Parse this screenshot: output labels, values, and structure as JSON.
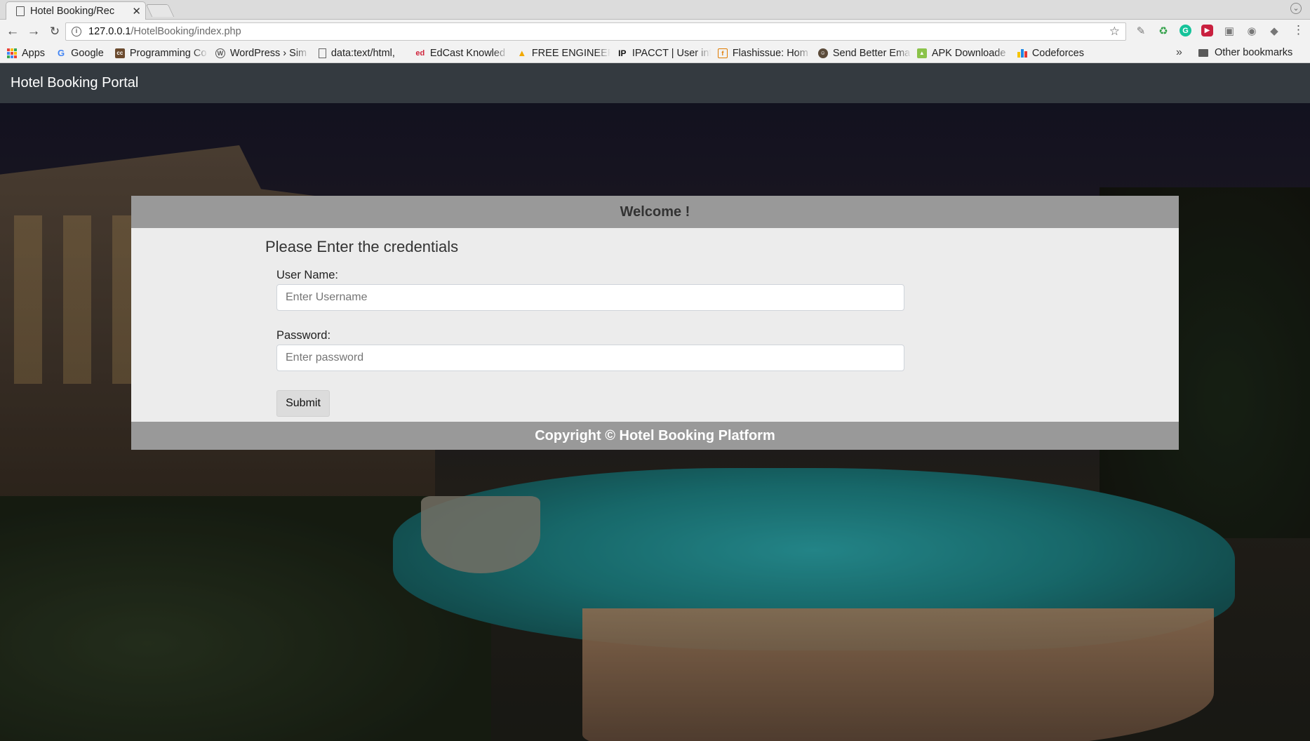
{
  "browser": {
    "tab_title": "Hotel Booking/Rec",
    "url_host": "127.0.0.1",
    "url_path": "/HotelBooking/index.php",
    "bookmarks": [
      {
        "label": "Apps",
        "icon": "apps-grid-icon"
      },
      {
        "label": "Google",
        "icon": "google-icon"
      },
      {
        "label": "Programming Co",
        "icon": "cc-icon"
      },
      {
        "label": "WordPress › Sim",
        "icon": "wordpress-icon"
      },
      {
        "label": "data:text/html,",
        "icon": "page-icon"
      },
      {
        "label": "EdCast Knowled",
        "icon": "edcast-icon"
      },
      {
        "label": "FREE ENGINEER",
        "icon": "triangle-icon"
      },
      {
        "label": "IPACCT | User inf",
        "icon": "ip-icon"
      },
      {
        "label": "Flashissue: Hom",
        "icon": "flashissue-icon"
      },
      {
        "label": "Send Better Ema",
        "icon": "mailchimp-icon"
      },
      {
        "label": "APK Downloade",
        "icon": "apk-icon"
      },
      {
        "label": "Codeforces",
        "icon": "codeforces-icon"
      }
    ],
    "other_bookmarks": "Other bookmarks"
  },
  "navbar": {
    "brand": "Hotel Booking Portal"
  },
  "card": {
    "header": "Welcome !",
    "title": "Please Enter the credentials",
    "username_label": "User Name:",
    "username_placeholder": "Enter Username",
    "password_label": "Password:",
    "password_placeholder": "Enter password",
    "submit_label": "Submit",
    "footer": "Copyright © Hotel Booking Platform"
  }
}
